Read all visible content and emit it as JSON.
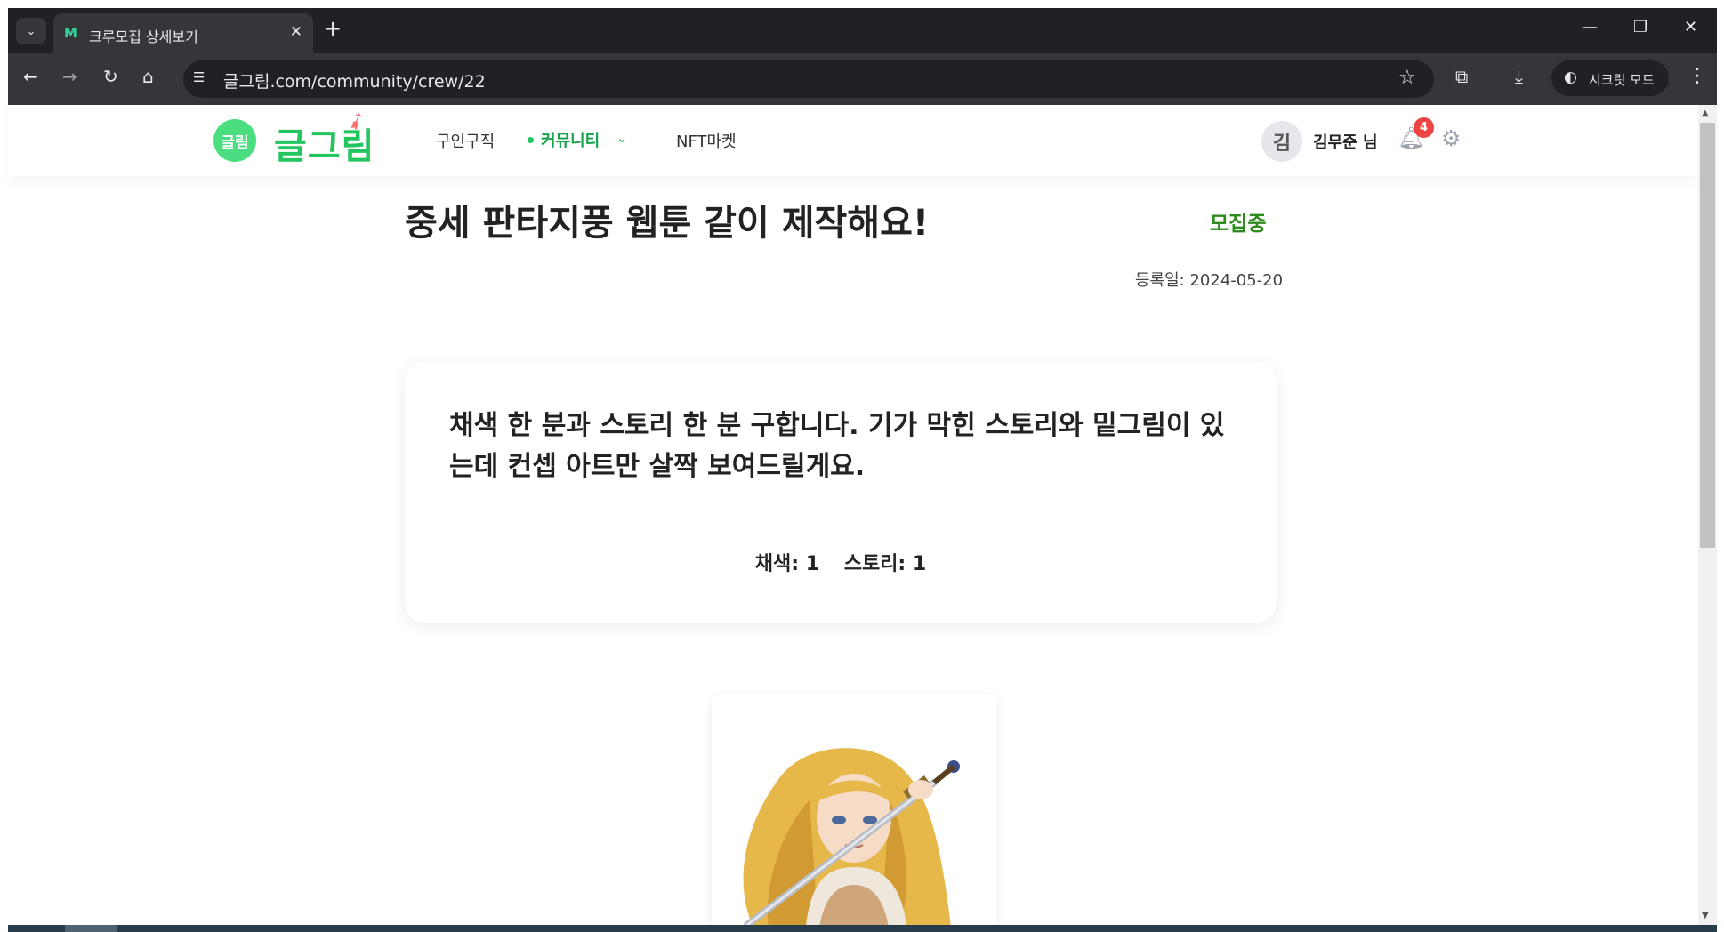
{
  "browser": {
    "tab_title": "크루모집 상세보기",
    "tab_favicon": "M",
    "url": "글그림.com/community/crew/22",
    "incognito_label": "시크릿 모드"
  },
  "header": {
    "logo_badge": "글림",
    "logo_text": "글그림",
    "nav": {
      "jobs": "구인구직",
      "community": "커뮤니티",
      "nft_market": "NFT마켓"
    },
    "user": {
      "avatar_initial": "김",
      "name": "김무준 님",
      "notification_count": "4"
    }
  },
  "post": {
    "title": "중세 판타지풍 웹툰 같이 제작해요!",
    "status": "모집중",
    "date": "등록일: 2024-05-20",
    "description": "채색 한 분과 스토리 한 분 구합니다. 기가 막힌 스토리와 밑그림이 있는데 컨셉 아트만 살짝 보여드릴게요.",
    "roles": [
      "채색: 1",
      "스토리: 1"
    ]
  },
  "colors": {
    "brand_green": "#22c55e",
    "status_green": "#2e8b1d",
    "badge_red": "#ef4444",
    "chrome_dark": "#202124"
  },
  "icons": [
    "tab-dropdown-icon",
    "favicon-icon",
    "close-icon",
    "plus-icon",
    "minimize-icon",
    "restore-icon",
    "window-close-icon",
    "back-icon",
    "forward-icon",
    "reload-icon",
    "home-icon",
    "site-info-icon",
    "star-icon",
    "extensions-icon",
    "download-icon",
    "incognito-icon",
    "menu-icon",
    "rocket-icon",
    "chevron-down-icon",
    "bell-icon",
    "gear-icon"
  ]
}
